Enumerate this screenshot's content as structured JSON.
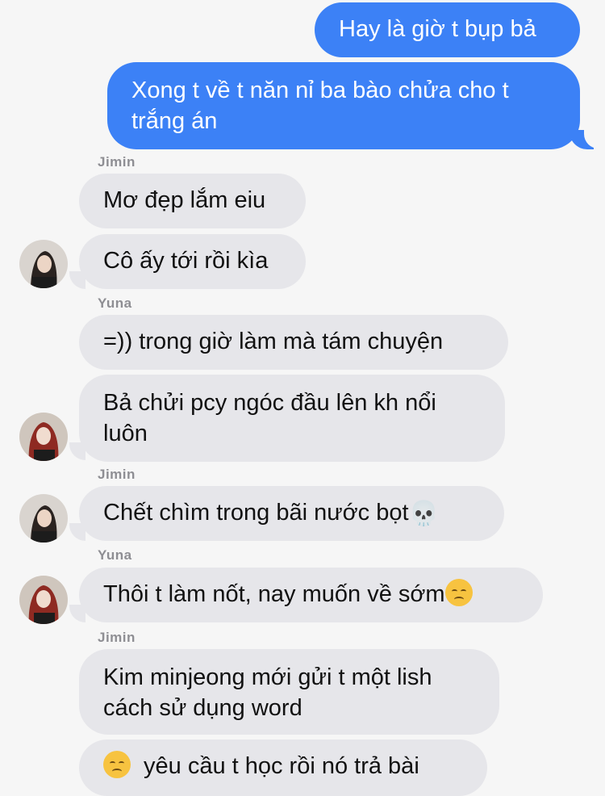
{
  "conversation": {
    "messages": [
      {
        "from": "me",
        "text": "Hay là giờ t bụp bả"
      },
      {
        "from": "me",
        "text": "Xong t về t năn nỉ ba bào chửa cho t trắng án"
      },
      {
        "sender_label": "Jimin"
      },
      {
        "from": "Jimin",
        "text": "Mơ đẹp lắm eiu"
      },
      {
        "from": "Jimin",
        "text": "Cô ấy tới rồi kìa"
      },
      {
        "sender_label": "Yuna"
      },
      {
        "from": "Yuna",
        "text": "=)) trong giờ làm mà tám chuyện"
      },
      {
        "from": "Yuna",
        "text": "Bả chửi pcy ngóc đầu lên kh nổi luôn"
      },
      {
        "sender_label": "Jimin"
      },
      {
        "from": "Jimin",
        "text": "Chết chìm trong bãi nước bọt",
        "emoji": "💀"
      },
      {
        "sender_label": "Yuna"
      },
      {
        "from": "Yuna",
        "text": "Thôi t làm nốt, nay muốn về sớm",
        "emoji": "sad-face-emoji"
      },
      {
        "sender_label": "Jimin"
      },
      {
        "from": "Jimin",
        "text": "Kim minjeong mới gửi t một lish cách sử dụng word"
      },
      {
        "from": "Jimin",
        "text": "yêu cầu t học rồi nó trả bài",
        "emoji_prefix": "sad-face-emoji"
      }
    ]
  },
  "colors": {
    "background": "#f6f6f6",
    "outgoing_bubble": "#3c81f6",
    "incoming_bubble": "#e6e6ea",
    "sender_label": "#8e8e93"
  }
}
